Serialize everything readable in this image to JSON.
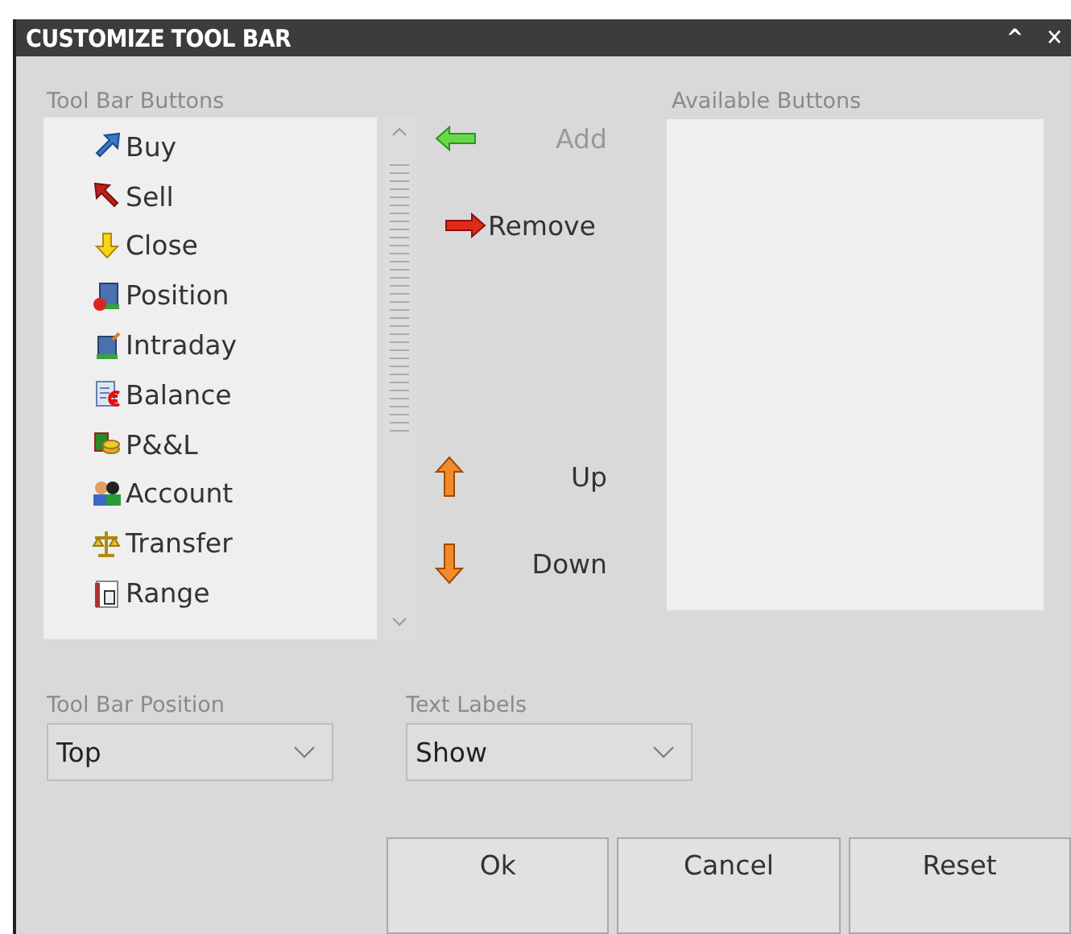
{
  "window": {
    "title": "CUSTOMIZE TOOL BAR",
    "controls": [
      "^",
      "✕"
    ]
  },
  "toolbar_buttons": {
    "label": "Tool Bar Buttons",
    "items": [
      {
        "label": "Buy"
      },
      {
        "label": "Sell"
      },
      {
        "label": "Close"
      },
      {
        "label": "Position"
      },
      {
        "label": "Intraday"
      },
      {
        "label": "Balance"
      },
      {
        "label": "P&&L"
      },
      {
        "label": "Account"
      },
      {
        "label": "Transfer"
      },
      {
        "label": "Range"
      }
    ]
  },
  "actions": [
    {
      "label": "Add",
      "disabled": true
    },
    {
      "label": "Remove",
      "disabled": false
    },
    {
      "label": "Up",
      "disabled": false
    },
    {
      "label": "Down",
      "disabled": false
    }
  ],
  "available_buttons": {
    "label": "Available Buttons"
  },
  "tool_bar_position": {
    "label": "Tool Bar Position",
    "value": "Top"
  },
  "text_labels": {
    "label": "Text Labels",
    "value": "Show"
  },
  "buttons": [
    "Ok",
    "Cancel",
    "Reset"
  ]
}
